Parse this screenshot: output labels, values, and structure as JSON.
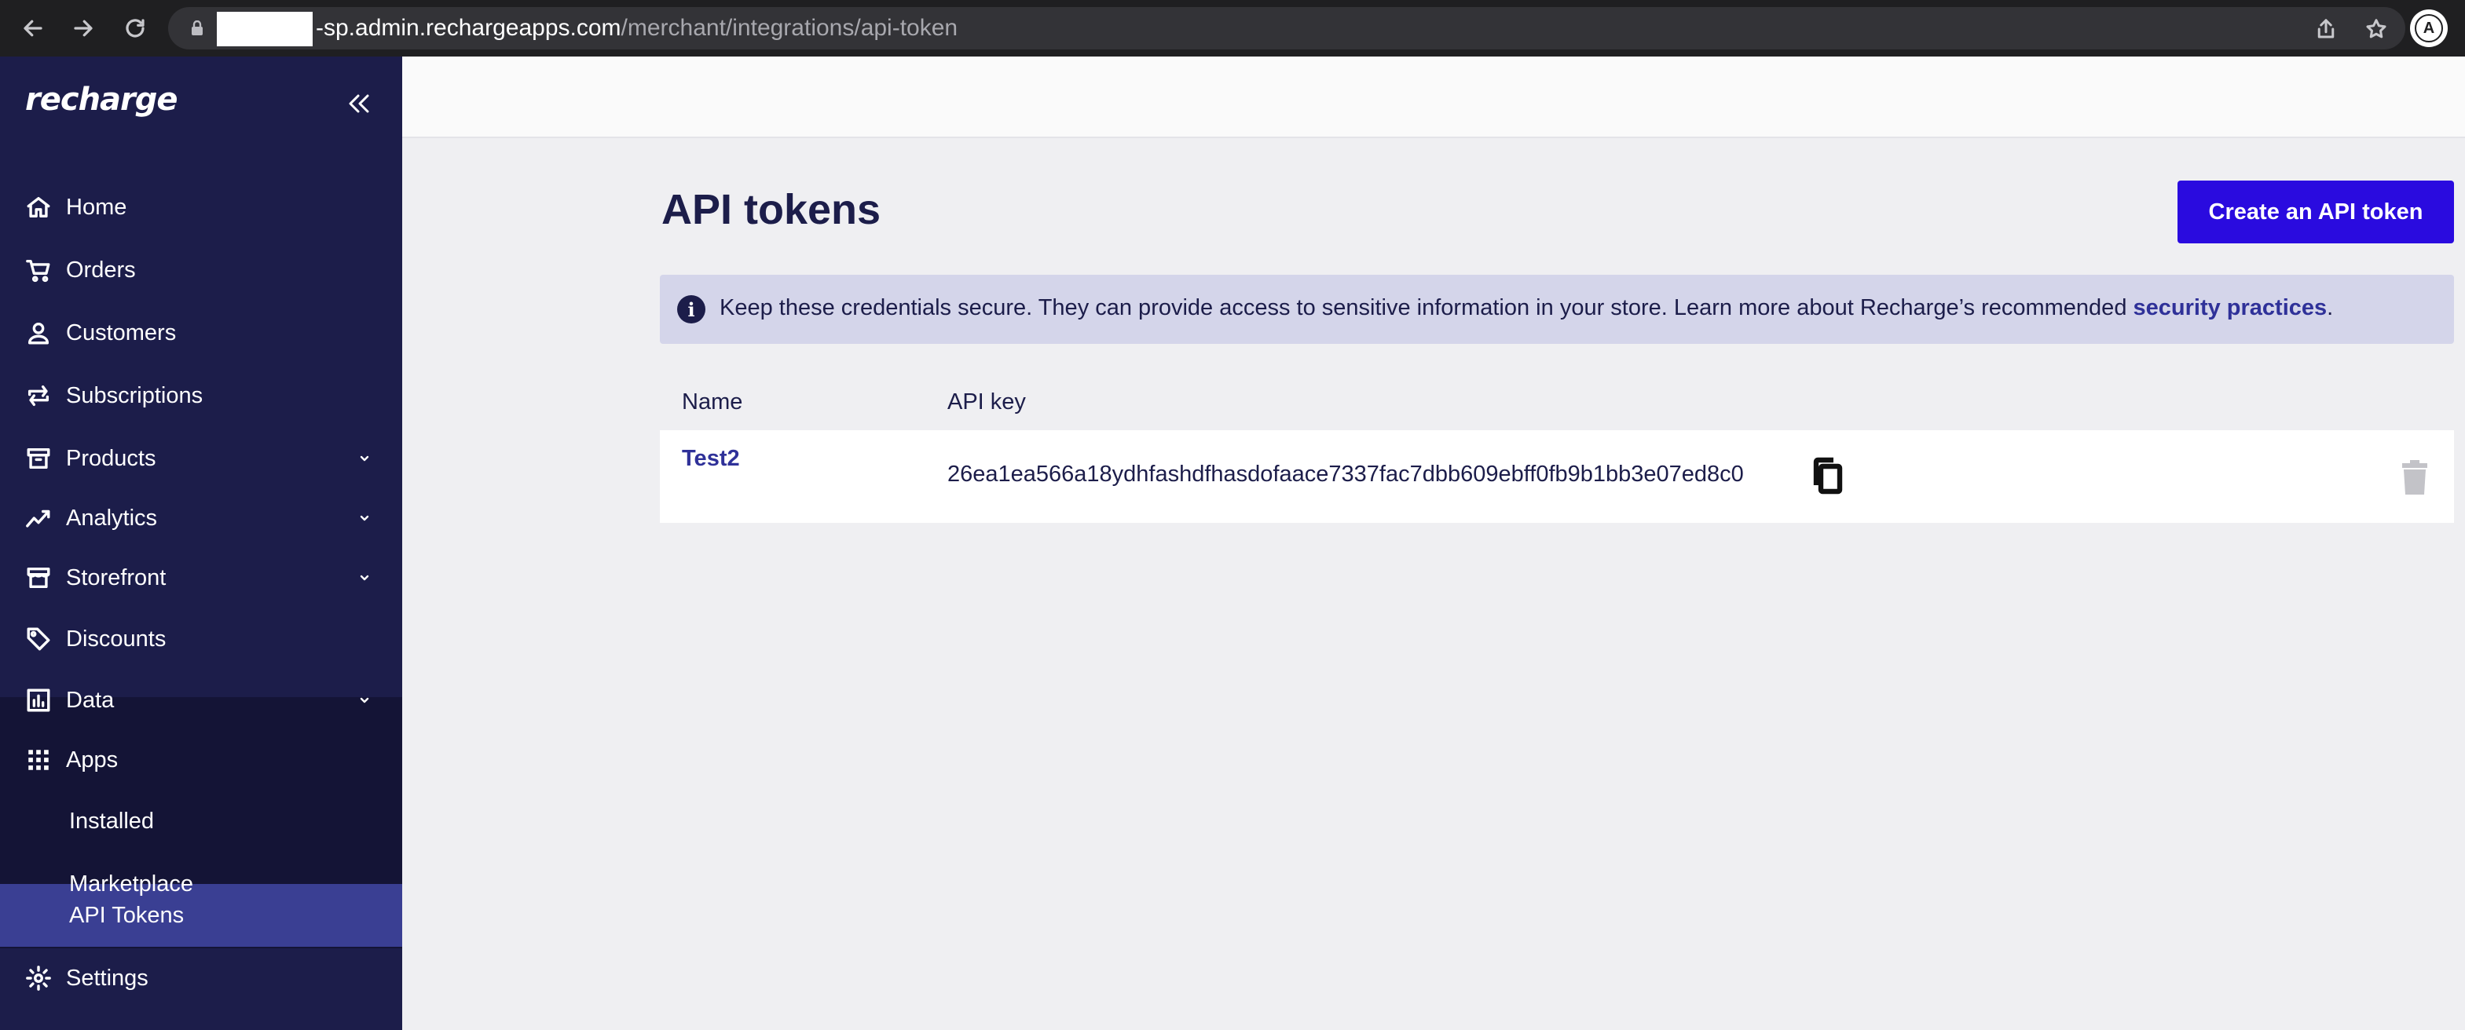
{
  "browser": {
    "url_host": "-sp.admin.rechargeapps.com",
    "url_path": "/merchant/integrations/api-token",
    "profile_initial": "A"
  },
  "sidebar": {
    "logo": "recharge",
    "items": [
      {
        "label": "Home",
        "icon": "home-icon"
      },
      {
        "label": "Orders",
        "icon": "cart-icon"
      },
      {
        "label": "Customers",
        "icon": "person-icon"
      },
      {
        "label": "Subscriptions",
        "icon": "repeat-icon"
      },
      {
        "label": "Products",
        "icon": "archive-icon",
        "expandable": true
      },
      {
        "label": "Analytics",
        "icon": "trend-icon",
        "expandable": true
      },
      {
        "label": "Storefront",
        "icon": "store-icon",
        "expandable": true
      },
      {
        "label": "Discounts",
        "icon": "tag-icon"
      },
      {
        "label": "Data",
        "icon": "bar-chart-icon",
        "expandable": true
      },
      {
        "label": "Apps",
        "icon": "grid-icon",
        "expanded": true
      },
      {
        "label": "Settings",
        "icon": "gear-icon"
      }
    ],
    "apps_subitems": [
      {
        "label": "Installed"
      },
      {
        "label": "Marketplace"
      },
      {
        "label": "API Tokens",
        "active": true
      }
    ]
  },
  "main": {
    "title": "API tokens",
    "create_button": "Create an API token",
    "banner": {
      "text": "Keep these credentials secure. They can provide access to sensitive information in your store. Learn more about Recharge’s recommended ",
      "link": "security practices",
      "suffix": "."
    },
    "table": {
      "columns": [
        "Name",
        "API key"
      ],
      "rows": [
        {
          "name": "Test2",
          "api_key": "26ea1ea566a18ydhfashdfhasdofaace7337fac7dbb609ebff0fb9b1bb3e07ed8c0"
        }
      ]
    }
  },
  "colors": {
    "sidebar_bg": "#1c1d4a",
    "accent": "#2a0bdf",
    "active_item": "#3a3f93",
    "banner_bg": "#d4d5ea"
  }
}
